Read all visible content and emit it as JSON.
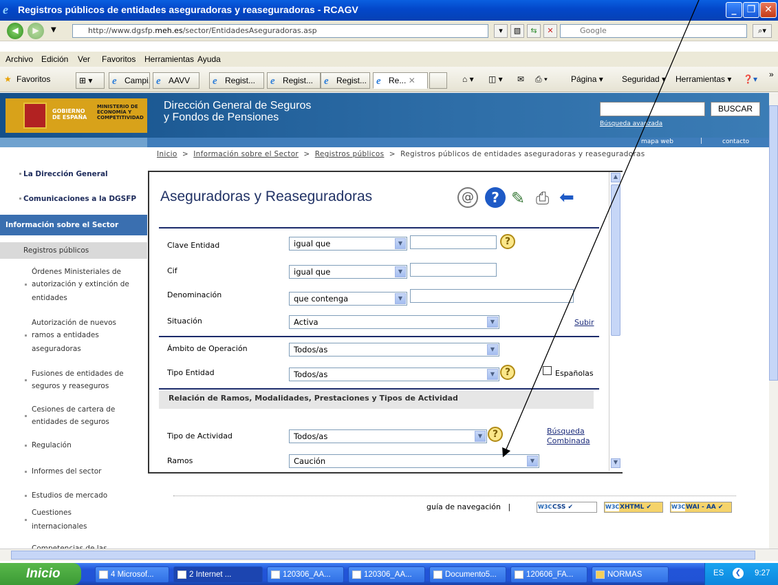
{
  "window": {
    "title": "Registros públicos de entidades aseguradoras y reaseguradoras - RCAGV"
  },
  "browser": {
    "url_prefix": "http://www.dgsfp.",
    "url_domain": "meh.es",
    "url_suffix": "/sector/EntidadesAseguradoras.asp",
    "search_placeholder": "Google",
    "menu": [
      "Archivo",
      "Edición",
      "Ver",
      "Favoritos",
      "Herramientas",
      "Ayuda"
    ],
    "favorites_label": "Favoritos",
    "tabs": [
      "Campi...",
      "AAVV",
      "Regist...",
      "Regist...",
      "Regist...",
      "Re..."
    ],
    "right_tools": [
      "Página",
      "Seguridad",
      "Herramientas"
    ]
  },
  "site": {
    "logo_gob": "GOBIERNO DE ESPAÑA",
    "logo_min": "MINISTERIO DE ECONOMÍA Y COMPETITIVIDAD",
    "title_line1": "Dirección General de Seguros",
    "title_line2": "y Fondos de Pensiones",
    "buscar": "BUSCAR",
    "busqueda_avanzada": "Búsqueda avanzada",
    "mapa_web": "mapa web",
    "contacto": "contacto"
  },
  "breadcrumb": {
    "inicio": "Inicio",
    "sep": ">",
    "informacion": "Información sobre el Sector",
    "registros": "Registros públicos",
    "current": "Registros públicos de entidades aseguradoras y reaseguradoras"
  },
  "sidebar": {
    "items": [
      "La Dirección General",
      "Comunicaciones a la DGSFP",
      "Información sobre el Sector",
      "Registros públicos",
      "Órdenes Ministeriales de",
      "autorización y extinción de",
      "entidades",
      "Autorización de nuevos",
      "ramos a entidades",
      "aseguradoras",
      "Fusiones de entidades de",
      "seguros y reaseguros",
      "Cesiones de cartera de",
      "entidades de seguros",
      "Regulación",
      "Informes del sector",
      "Estudios de mercado",
      "Cuestiones",
      "internacionales",
      "Competencias de las"
    ]
  },
  "form": {
    "title": "Aseguradoras y Reaseguradoras",
    "clave_label": "Clave Entidad",
    "clave_op": "igual que",
    "cif_label": "Cif",
    "cif_op": "igual que",
    "denom_label": "Denominación",
    "denom_op": "que contenga",
    "situacion_label": "Situación",
    "situacion_val": "Activa",
    "subir": "Subir",
    "ambito_label": "Ámbito de Operación",
    "ambito_val": "Todos/as",
    "tipo_entidad_label": "Tipo Entidad",
    "tipo_entidad_val": "Todos/as",
    "espanolas": "Españolas",
    "relacion_heading": "Relación de Ramos, Modalidades, Prestaciones y Tipos de Actividad",
    "tipo_actividad_label": "Tipo de Actividad",
    "tipo_actividad_val": "Todos/as",
    "busqueda_l1": "Búsqueda",
    "busqueda_l2": "Combinada",
    "ramos_label": "Ramos",
    "ramos_val": "Caución"
  },
  "footer": {
    "guia": "guía de navegación",
    "sep": "|",
    "badges": [
      "CSS",
      "XHTML",
      "WAI - AA"
    ],
    "w3c": "W3C"
  },
  "taskbar": {
    "start": "Inicio",
    "tasks": [
      "4 Microsof...",
      "2 Internet ...",
      "120306_AA...",
      "120306_AA...",
      "Documento5...",
      "120606_FA...",
      "NORMAS"
    ],
    "lang": "ES",
    "time": "9:27"
  }
}
